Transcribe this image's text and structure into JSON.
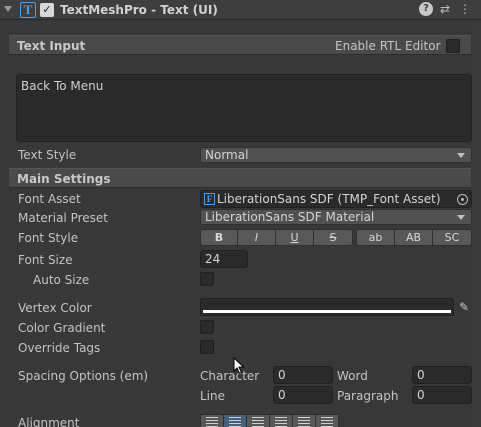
{
  "header": {
    "title": "TextMeshPro - Text (UI)",
    "enabled": true
  },
  "text_input": {
    "section_title": "Text Input",
    "rtl_label": "Enable RTL Editor",
    "rtl_enabled": false,
    "text": "Back To Menu",
    "text_style_label": "Text Style",
    "text_style_value": "Normal"
  },
  "main_settings": {
    "section_title": "Main Settings",
    "font_asset_label": "Font Asset",
    "font_asset_value": "LiberationSans SDF (TMP_Font Asset)",
    "material_preset_label": "Material Preset",
    "material_preset_value": "LiberationSans SDF Material",
    "font_style_label": "Font Style",
    "font_style_buttons": [
      "B",
      "I",
      "U",
      "S",
      "ab",
      "AB",
      "SC"
    ],
    "font_size_label": "Font Size",
    "font_size_value": "24",
    "auto_size_label": "Auto Size",
    "auto_size": false,
    "vertex_color_label": "Vertex Color",
    "vertex_color": "#ffffff",
    "color_gradient_label": "Color Gradient",
    "color_gradient": false,
    "override_tags_label": "Override Tags",
    "override_tags": false,
    "spacing_label": "Spacing Options (em)",
    "spacing": {
      "character_label": "Character",
      "character_value": "0",
      "word_label": "Word",
      "word_value": "0",
      "line_label": "Line",
      "line_value": "0",
      "paragraph_label": "Paragraph",
      "paragraph_value": "0"
    },
    "alignment_label": "Alignment",
    "alignment_selected": 1
  },
  "icons": [
    "text-component-icon",
    "help-icon",
    "presets-icon",
    "more-icon",
    "eyedropper-icon",
    "object-picker-icon"
  ]
}
